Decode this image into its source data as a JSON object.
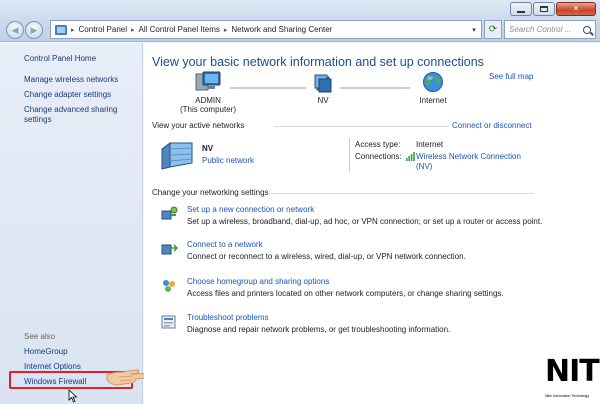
{
  "window": {
    "breadcrumb": [
      "Control Panel",
      "All Control Panel Items",
      "Network and Sharing Center"
    ],
    "search_placeholder": "Search Control ..."
  },
  "sidebar": {
    "home": "Control Panel Home",
    "links": [
      "Manage wireless networks",
      "Change adapter settings",
      "Change advanced sharing settings"
    ],
    "see_also_label": "See also",
    "see_also": [
      "HomeGroup",
      "Internet Options",
      "Windows Firewall"
    ]
  },
  "main": {
    "heading": "View your basic network information and set up connections",
    "see_full_map": "See full map",
    "map_nodes": [
      {
        "name": "ADMIN",
        "sub": "(This computer)"
      },
      {
        "name": "NV",
        "sub": ""
      },
      {
        "name": "Internet",
        "sub": ""
      }
    ],
    "active_section": "View your active networks",
    "connect_disconnect": "Connect or disconnect",
    "active_network": {
      "name": "NV",
      "type": "Public network",
      "access_type_label": "Access type:",
      "access_type_value": "Internet",
      "connections_label": "Connections:",
      "connection_link": "Wireless Network Connection (NV)"
    },
    "change_section": "Change your networking settings",
    "tasks": [
      {
        "title": "Set up a new connection or network",
        "desc": "Set up a wireless, broadband, dial-up, ad hoc, or VPN connection; or set up a router or access point.",
        "icon": "new-connection-icon"
      },
      {
        "title": "Connect to a network",
        "desc": "Connect or reconnect to a wireless, wired, dial-up, or VPN network connection.",
        "icon": "connect-network-icon"
      },
      {
        "title": "Choose homegroup and sharing options",
        "desc": "Access files and printers located on other network computers, or change sharing settings.",
        "icon": "homegroup-icon"
      },
      {
        "title": "Troubleshoot problems",
        "desc": "Diagnose and repair network problems, or get troubleshooting information.",
        "icon": "troubleshoot-icon"
      }
    ]
  },
  "logo": {
    "text": "NIT",
    "tagline": "Nitin Information Technology"
  },
  "colors": {
    "link": "#1a55b5",
    "heading": "#1d4c8f",
    "highlight": "#e21f26"
  }
}
